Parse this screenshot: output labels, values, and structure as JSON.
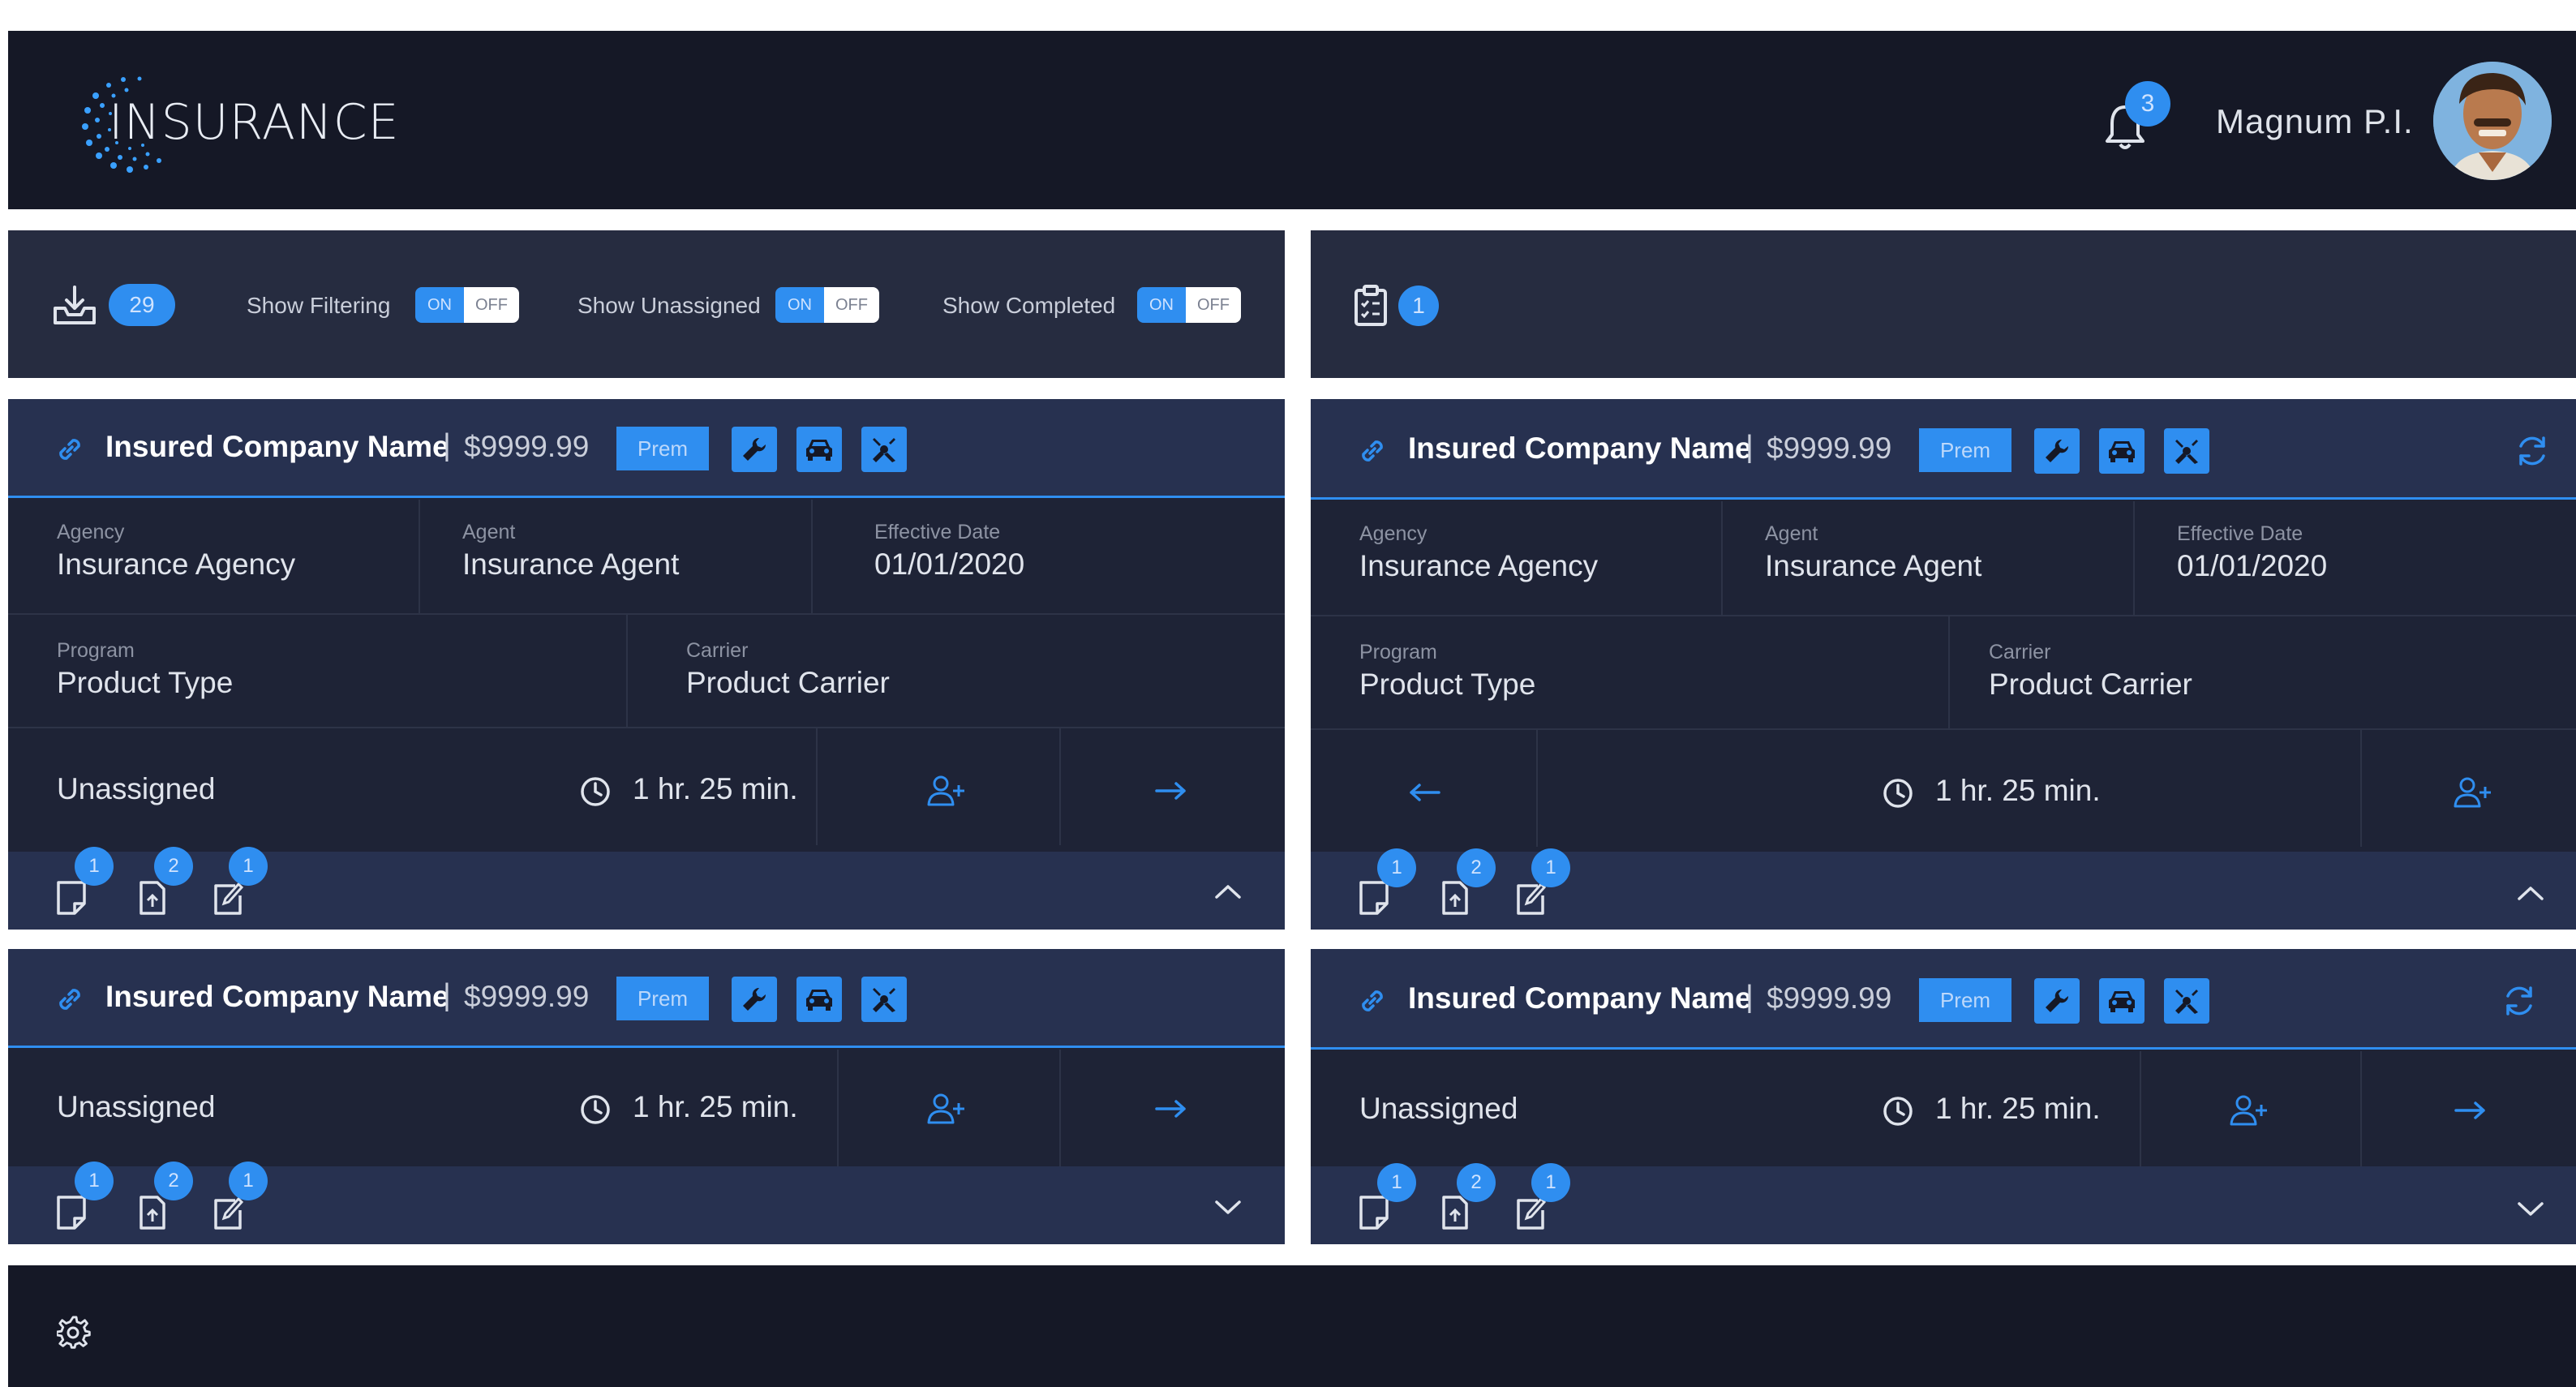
{
  "header": {
    "logo_text": "INSURANCE",
    "notifications_count": "3",
    "user_name": "Magnum P.I."
  },
  "filter_bar": {
    "inbox_count": "29",
    "filters": [
      {
        "label": "Show Filtering",
        "on": "ON",
        "off": "OFF"
      },
      {
        "label": "Show Unassigned",
        "on": "ON",
        "off": "OFF"
      },
      {
        "label": "Show Completed",
        "on": "ON",
        "off": "OFF"
      }
    ]
  },
  "task_bar": {
    "task_count": "1"
  },
  "cards": [
    {
      "title": "Insured Company Name",
      "separator": "|",
      "price": "$9999.99",
      "prem_label": "Prem",
      "agency_label": "Agency",
      "agency": "Insurance Agency",
      "agent_label": "Agent",
      "agent": "Insurance Agent",
      "date_label": "Effective Date",
      "date": "01/01/2020",
      "program_label": "Program",
      "program": "Product Type",
      "carrier_label": "Carrier",
      "carrier": "Product Carrier",
      "status": "Unassigned",
      "time": "1 hr. 25 min.",
      "badges": [
        "1",
        "2",
        "1"
      ]
    },
    {
      "title": "Insured Company Name",
      "separator": "|",
      "price": "$9999.99",
      "prem_label": "Prem",
      "agency_label": "Agency",
      "agency": "Insurance Agency",
      "agent_label": "Agent",
      "agent": "Insurance Agent",
      "date_label": "Effective Date",
      "date": "01/01/2020",
      "program_label": "Program",
      "program": "Product Type",
      "carrier_label": "Carrier",
      "carrier": "Product Carrier",
      "time": "1 hr. 25 min.",
      "badges": [
        "1",
        "2",
        "1"
      ]
    },
    {
      "title": "Insured Company Name",
      "separator": "|",
      "price": "$9999.99",
      "prem_label": "Prem",
      "status": "Unassigned",
      "time": "1 hr. 25 min.",
      "badges": [
        "1",
        "2",
        "1"
      ]
    },
    {
      "title": "Insured Company Name",
      "separator": "|",
      "price": "$9999.99",
      "prem_label": "Prem",
      "status": "Unassigned",
      "time": "1 hr. 25 min.",
      "badges": [
        "1",
        "2",
        "1"
      ]
    }
  ],
  "colors": {
    "accent": "#2f8ef0",
    "header_bg": "#151826",
    "panel_bg": "#262c40",
    "card_bg": "#1e2336",
    "card_head_bg": "#273150"
  }
}
